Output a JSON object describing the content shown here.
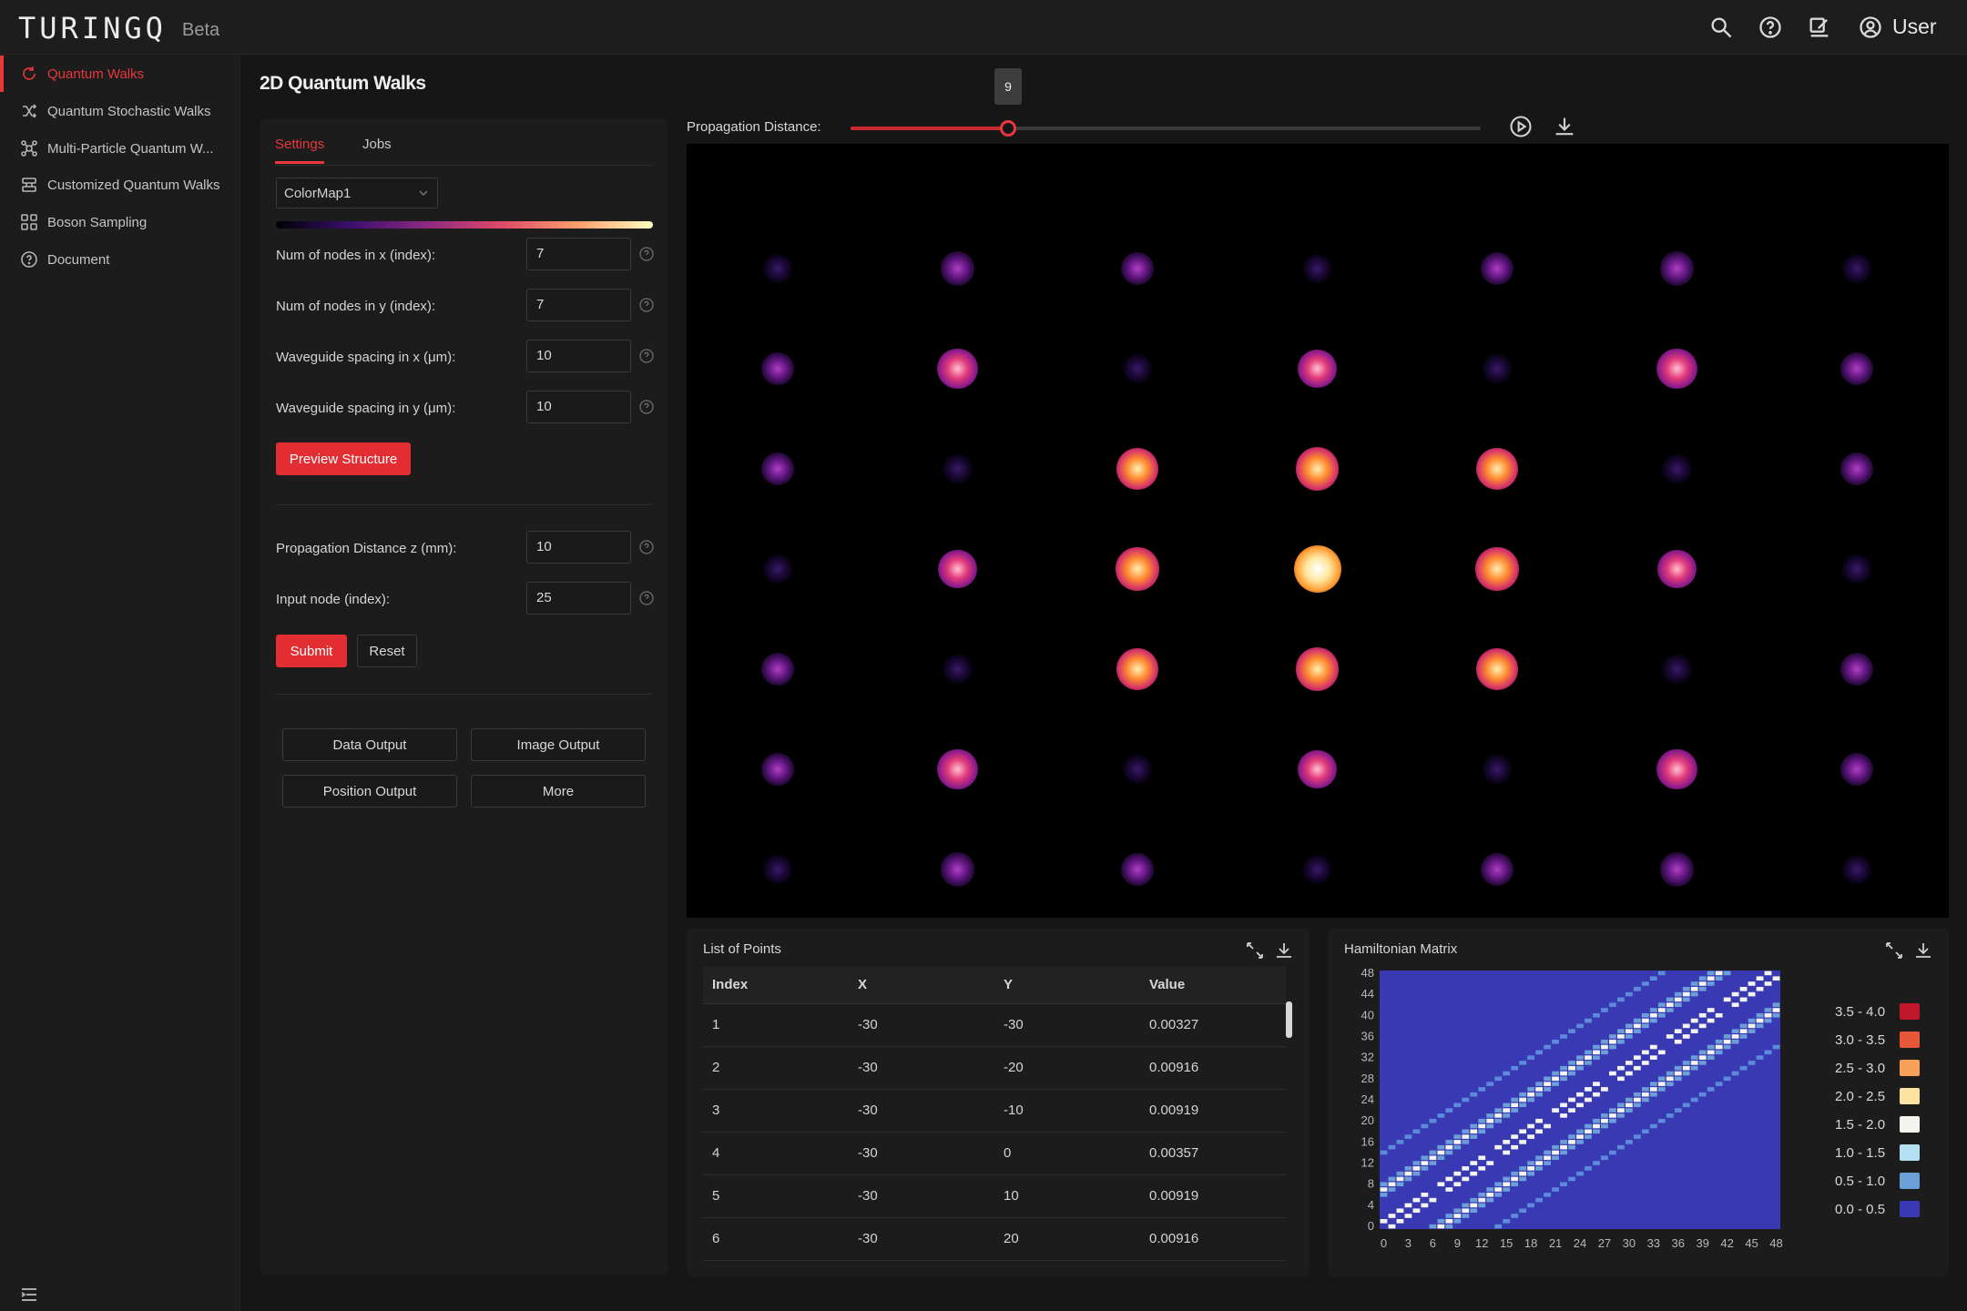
{
  "app": {
    "logo": "TURINGQ",
    "beta": "Beta",
    "user": "User"
  },
  "sidebar": {
    "items": [
      {
        "label": "Quantum Walks",
        "icon": "refresh-icon",
        "active": true
      },
      {
        "label": "Quantum Stochastic Walks",
        "icon": "shuffle-icon",
        "active": false
      },
      {
        "label": "Multi-Particle Quantum W...",
        "icon": "network-icon",
        "active": false
      },
      {
        "label": "Customized Quantum Walks",
        "icon": "layers-icon",
        "active": false
      },
      {
        "label": "Boson Sampling",
        "icon": "nodes-icon",
        "active": false
      },
      {
        "label": "Document",
        "icon": "help-circle-icon",
        "active": false
      }
    ]
  },
  "page": {
    "title": "2D Quantum Walks"
  },
  "settings": {
    "tabs": [
      "Settings",
      "Jobs"
    ],
    "colormap": "ColorMap1",
    "fields": [
      {
        "label": "Num of nodes in x (index):",
        "value": "7"
      },
      {
        "label": "Num of nodes in y (index):",
        "value": "7"
      },
      {
        "label": "Waveguide spacing in x (μm):",
        "value": "10"
      },
      {
        "label": "Waveguide spacing in y (μm):",
        "value": "10"
      }
    ],
    "preview_label": "Preview Structure",
    "fields2": [
      {
        "label": "Propagation Distance z (mm):",
        "value": "10"
      },
      {
        "label": "Input node (index):",
        "value": "25"
      }
    ],
    "submit_label": "Submit",
    "reset_label": "Reset",
    "outputs": [
      "Data Output",
      "Image Output",
      "Position Output",
      "More"
    ]
  },
  "propagation": {
    "label": "Propagation Distance:",
    "value": 9,
    "min": 0,
    "max": 36
  },
  "intensity_grid": [
    [
      0.08,
      0.35,
      0.3,
      0.08,
      0.3,
      0.35,
      0.08
    ],
    [
      0.3,
      0.65,
      0.1,
      0.55,
      0.1,
      0.65,
      0.3
    ],
    [
      0.3,
      0.1,
      0.72,
      0.78,
      0.72,
      0.1,
      0.3
    ],
    [
      0.08,
      0.55,
      0.78,
      1.0,
      0.78,
      0.55,
      0.08
    ],
    [
      0.3,
      0.1,
      0.72,
      0.78,
      0.72,
      0.1,
      0.3
    ],
    [
      0.3,
      0.65,
      0.1,
      0.55,
      0.1,
      0.65,
      0.3
    ],
    [
      0.08,
      0.35,
      0.3,
      0.08,
      0.3,
      0.35,
      0.08
    ]
  ],
  "points": {
    "title": "List of Points",
    "columns": [
      "Index",
      "X",
      "Y",
      "Value"
    ],
    "rows": [
      [
        "1",
        "-30",
        "-30",
        "0.00327"
      ],
      [
        "2",
        "-30",
        "-20",
        "0.00916"
      ],
      [
        "3",
        "-30",
        "-10",
        "0.00919"
      ],
      [
        "4",
        "-30",
        "0",
        "0.00357"
      ],
      [
        "5",
        "-30",
        "10",
        "0.00919"
      ],
      [
        "6",
        "-30",
        "20",
        "0.00916"
      ]
    ]
  },
  "hamiltonian": {
    "title": "Hamiltonian Matrix",
    "size": 49,
    "x_ticks": [
      "0",
      "3",
      "6",
      "9",
      "12",
      "15",
      "18",
      "21",
      "24",
      "27",
      "30",
      "33",
      "36",
      "39",
      "42",
      "45",
      "48"
    ],
    "y_ticks": [
      "0",
      "4",
      "8",
      "12",
      "16",
      "20",
      "24",
      "28",
      "32",
      "36",
      "40",
      "44",
      "48"
    ],
    "legend": [
      {
        "label": "3.5 - 4.0",
        "color": "#c0182a"
      },
      {
        "label": "3.0 - 3.5",
        "color": "#e8573a"
      },
      {
        "label": "2.5 - 3.0",
        "color": "#f6a05a"
      },
      {
        "label": "2.0 - 2.5",
        "color": "#fde3a0"
      },
      {
        "label": "1.5 - 2.0",
        "color": "#f4f4ee"
      },
      {
        "label": "1.0 - 1.5",
        "color": "#b3dff0"
      },
      {
        "label": "0.5 - 1.0",
        "color": "#6a9fd8"
      },
      {
        "label": "0.0 - 0.5",
        "color": "#3a39b4"
      }
    ]
  },
  "colors": {
    "accent": "#e22d33",
    "matrix_bg": "#3a39b4",
    "matrix_diag": "#5c8bd9"
  }
}
